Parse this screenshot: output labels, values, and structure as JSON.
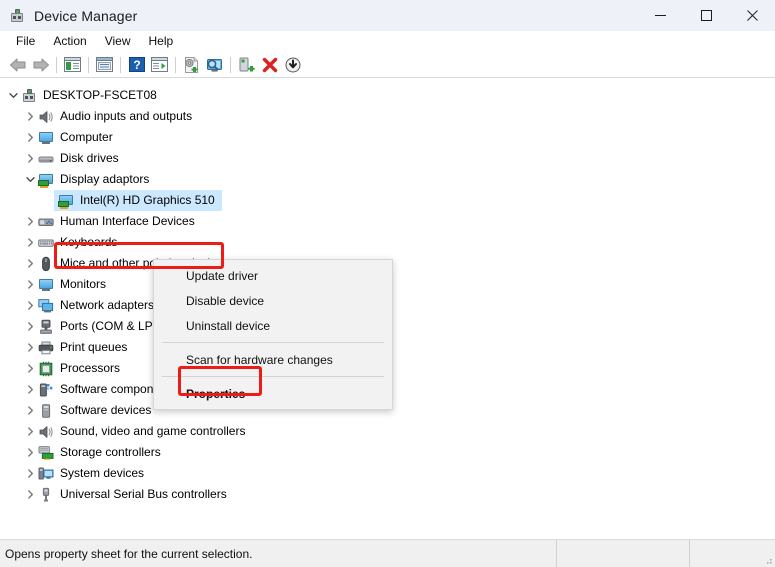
{
  "window": {
    "title": "Device Manager",
    "icon": "device-manager-icon",
    "controls": {
      "minimize": "minimize-icon",
      "maximize": "maximize-icon",
      "close": "close-icon"
    }
  },
  "menubar": {
    "items": [
      {
        "label": "File"
      },
      {
        "label": "Action"
      },
      {
        "label": "View"
      },
      {
        "label": "Help"
      }
    ]
  },
  "toolbar": {
    "buttons": [
      {
        "name": "back-button",
        "icon": "arrow-left-icon"
      },
      {
        "name": "forward-button",
        "icon": "arrow-right-icon"
      },
      {
        "name": "separator-1",
        "icon": "separator"
      },
      {
        "name": "show-hide-console-tree-button",
        "icon": "console-tree-icon"
      },
      {
        "name": "separator-2",
        "icon": "separator"
      },
      {
        "name": "properties-button",
        "icon": "properties-window-icon"
      },
      {
        "name": "separator-3",
        "icon": "separator"
      },
      {
        "name": "help-button",
        "icon": "help-question-icon"
      },
      {
        "name": "show-hide-action-pane-button",
        "icon": "action-pane-icon"
      },
      {
        "name": "separator-4",
        "icon": "separator"
      },
      {
        "name": "update-driver-button",
        "icon": "update-driver-icon"
      },
      {
        "name": "scan-hardware-changes-button",
        "icon": "scan-hardware-icon"
      },
      {
        "name": "separator-5",
        "icon": "separator"
      },
      {
        "name": "enable-device-button",
        "icon": "enable-device-icon"
      },
      {
        "name": "uninstall-device-button",
        "icon": "red-x-icon"
      },
      {
        "name": "disable-device-button",
        "icon": "down-arrow-circle-icon"
      }
    ]
  },
  "tree": {
    "root": {
      "label": "DESKTOP-FSCET08",
      "icon": "computer-root-icon",
      "expanded": true
    },
    "items": [
      {
        "label": "Audio inputs and outputs",
        "icon": "speaker-icon",
        "expanded": false,
        "level": 1
      },
      {
        "label": "Computer",
        "icon": "monitor-icon",
        "expanded": false,
        "level": 1
      },
      {
        "label": "Disk drives",
        "icon": "disk-drive-icon",
        "expanded": false,
        "level": 1
      },
      {
        "label": "Display adaptors",
        "icon": "display-adapter-icon",
        "expanded": true,
        "level": 1
      },
      {
        "label": "Intel(R) HD Graphics 510",
        "icon": "display-adapter-icon",
        "expanded": null,
        "level": 2,
        "selected": true
      },
      {
        "label": "Human Interface Devices",
        "icon": "hid-icon",
        "expanded": false,
        "level": 1
      },
      {
        "label": "Keyboards",
        "icon": "keyboard-icon",
        "expanded": false,
        "level": 1
      },
      {
        "label": "Mice and other pointing devices",
        "icon": "mouse-icon",
        "expanded": false,
        "level": 1
      },
      {
        "label": "Monitors",
        "icon": "monitor-icon",
        "expanded": false,
        "level": 1
      },
      {
        "label": "Network adapters",
        "icon": "network-adapter-icon",
        "expanded": false,
        "level": 1
      },
      {
        "label": "Ports (COM & LPT)",
        "icon": "port-icon",
        "expanded": false,
        "level": 1
      },
      {
        "label": "Print queues",
        "icon": "printer-icon",
        "expanded": false,
        "level": 1
      },
      {
        "label": "Processors",
        "icon": "processor-icon",
        "expanded": false,
        "level": 1
      },
      {
        "label": "Software components",
        "icon": "software-component-icon",
        "expanded": false,
        "level": 1
      },
      {
        "label": "Software devices",
        "icon": "software-device-icon",
        "expanded": false,
        "level": 1
      },
      {
        "label": "Sound, video and game controllers",
        "icon": "speaker-icon",
        "expanded": false,
        "level": 1
      },
      {
        "label": "Storage controllers",
        "icon": "storage-controller-icon",
        "expanded": false,
        "level": 1
      },
      {
        "label": "System devices",
        "icon": "system-device-icon",
        "expanded": false,
        "level": 1
      },
      {
        "label": "Universal Serial Bus controllers",
        "icon": "usb-icon",
        "expanded": false,
        "level": 1
      }
    ]
  },
  "context_menu": {
    "items": [
      {
        "label": "Update driver",
        "bold": false,
        "type": "item"
      },
      {
        "label": "Disable device",
        "bold": false,
        "type": "item"
      },
      {
        "label": "Uninstall device",
        "bold": false,
        "type": "item"
      },
      {
        "type": "separator"
      },
      {
        "label": "Scan for hardware changes",
        "bold": false,
        "type": "item"
      },
      {
        "type": "separator"
      },
      {
        "label": "Properties",
        "bold": true,
        "type": "item"
      }
    ]
  },
  "statusbar": {
    "message": "Opens property sheet for the current selection.",
    "pane2": "",
    "pane3": ""
  },
  "annotations": {
    "highlight_color": "#ee1c16",
    "boxes": [
      {
        "name": "selected-device-highlight",
        "target": "Intel(R) HD Graphics 510"
      },
      {
        "name": "properties-menu-highlight",
        "target": "Properties"
      }
    ]
  },
  "colors": {
    "titlebar_bg": "#eef1f7",
    "selection_bg": "#cce8ff",
    "menu_bg": "#f2f2f2",
    "status_bg": "#f0f0f0",
    "accent_red": "#ee1c16"
  }
}
